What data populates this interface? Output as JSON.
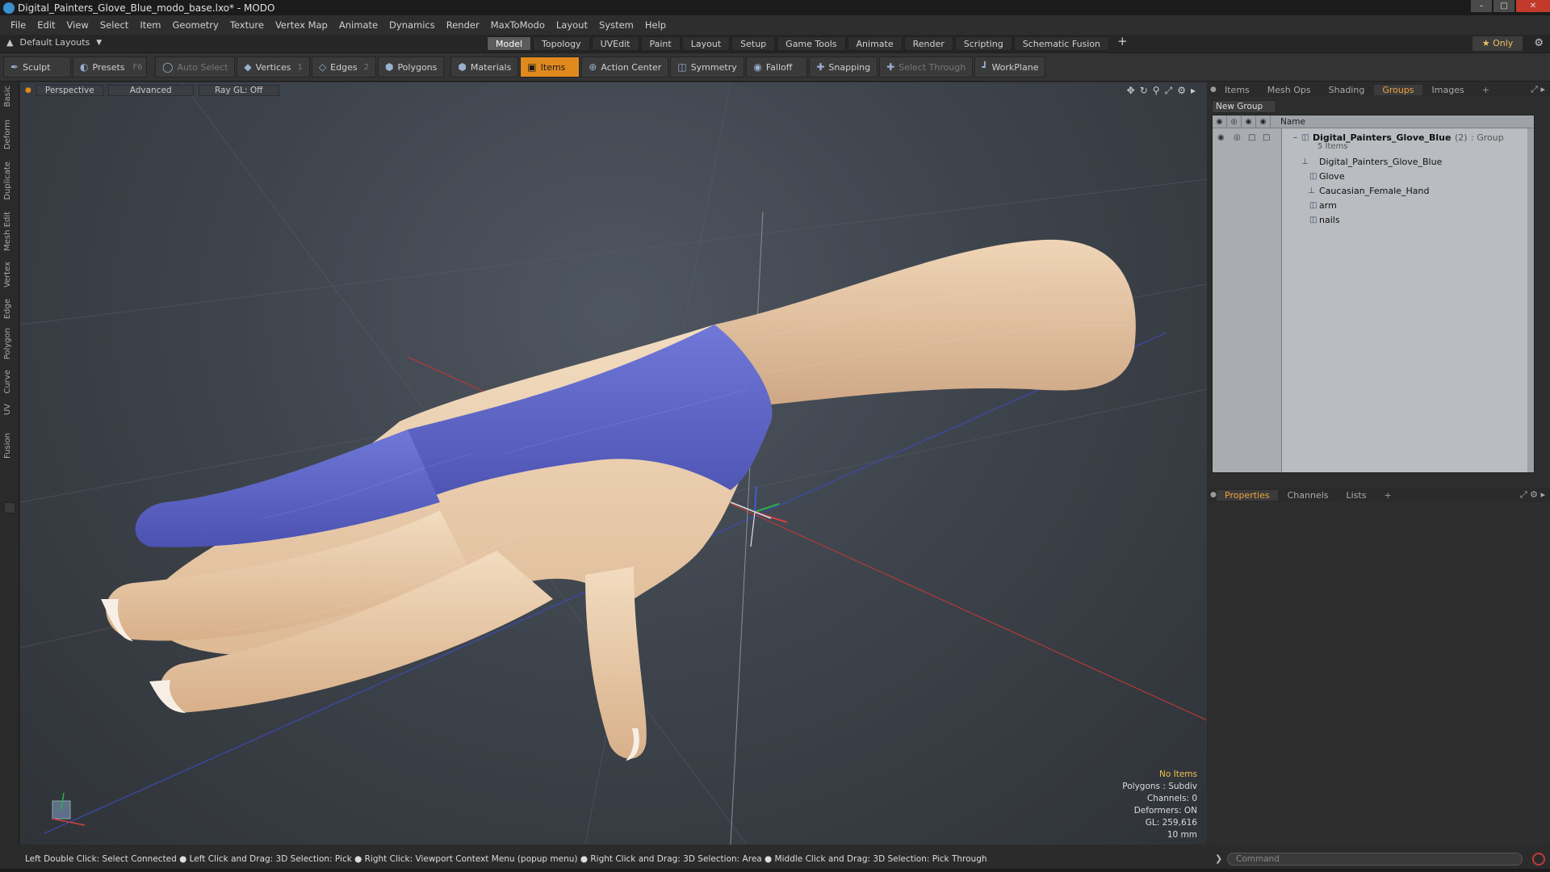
{
  "window": {
    "title": "Digital_Painters_Glove_Blue_modo_base.lxo* - MODO",
    "controls": [
      "–",
      "□",
      "✕"
    ]
  },
  "menu": [
    "File",
    "Edit",
    "View",
    "Select",
    "Item",
    "Geometry",
    "Texture",
    "Vertex Map",
    "Animate",
    "Dynamics",
    "Render",
    "MaxToModo",
    "Layout",
    "System",
    "Help"
  ],
  "layout_selector": "Default Layouts",
  "main_tabs": [
    "Model",
    "Topology",
    "UVEdit",
    "Paint",
    "Layout",
    "Setup",
    "Game Tools",
    "Animate",
    "Render",
    "Scripting",
    "Schematic Fusion"
  ],
  "active_main_tab": "Model",
  "only_label": "★ Only",
  "toolbar": {
    "sculpt": "Sculpt",
    "presets": "Presets",
    "presets_key": "F6",
    "auto_select": "Auto Select",
    "vertices": "Vertices",
    "vertices_count": "1",
    "edges": "Edges",
    "edges_count": "2",
    "polygons": "Polygons",
    "materials": "Materials",
    "items": "Items",
    "action_center": "Action Center",
    "symmetry": "Symmetry",
    "falloff": "Falloff",
    "snapping": "Snapping",
    "select_through": "Select Through",
    "workplane": "WorkPlane"
  },
  "left_tabs": [
    "Basic",
    "Deform",
    "Duplicate",
    "Mesh Edit",
    "Vertex",
    "Edge",
    "Polygon",
    "Curve",
    "UV",
    "Fusion"
  ],
  "viewport": {
    "view": "Perspective",
    "shading": "Advanced",
    "raygl": "Ray GL: Off",
    "info": {
      "items": "No Items",
      "polygons": "Polygons : Subdiv",
      "channels": "Channels: 0",
      "deformers": "Deformers: ON",
      "gl": "GL: 259,616",
      "scale": "10 mm"
    }
  },
  "items_panel": {
    "tabs": [
      "Items",
      "Mesh Ops",
      "Shading",
      "Groups",
      "Images"
    ],
    "active_tab": "Groups",
    "new_group": "New Group",
    "column_name": "Name",
    "group": {
      "name": "Digital_Painters_Glove_Blue",
      "count": "(2)",
      "type": ": Group",
      "sub": "5 Items"
    },
    "children": [
      "Digital_Painters_Glove_Blue",
      "Glove",
      "Caucasian_Female_Hand",
      "arm",
      "nails"
    ]
  },
  "properties_panel": {
    "tabs": [
      "Properties",
      "Channels",
      "Lists"
    ],
    "active_tab": "Properties"
  },
  "status": "Left Double Click: Select Connected ● Left Click and Drag: 3D Selection: Pick ● Right Click: Viewport Context Menu (popup menu) ● Right Click and Drag: 3D Selection: Area ● Middle Click and Drag: 3D Selection: Pick Through",
  "command_placeholder": "Command",
  "colors": {
    "accent_orange": "#e08a1e",
    "glove_blue": "#5a63c8",
    "skin": "#e8c9a6"
  }
}
